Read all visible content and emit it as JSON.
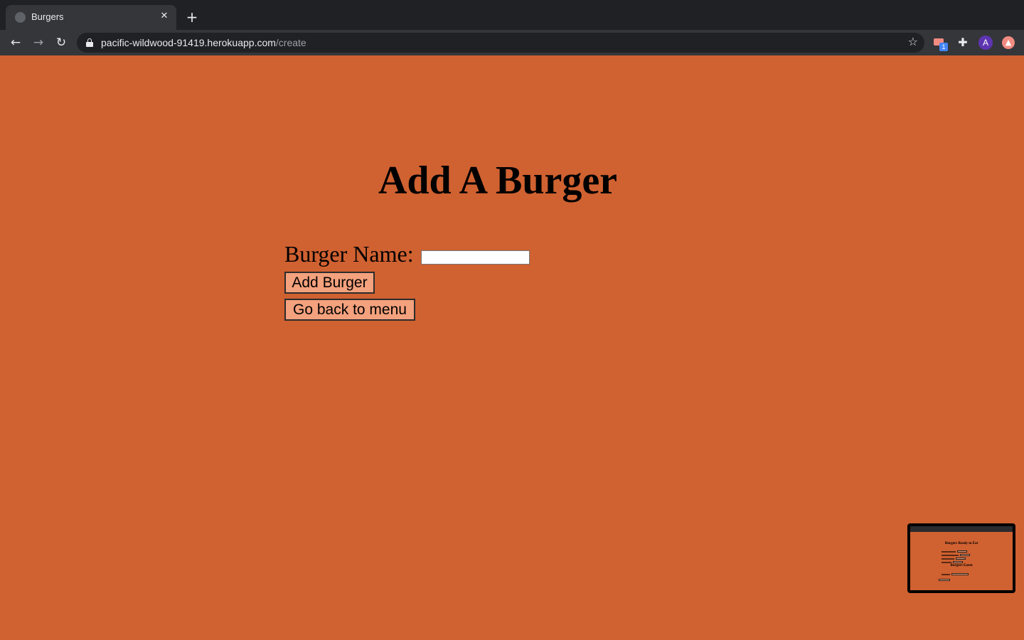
{
  "browser": {
    "tab_title": "Burgers",
    "tab_close": "✕",
    "new_tab": "+",
    "url_host": "pacific-wildwood-91419.herokuapp.com",
    "url_path": "/create",
    "extension_badge": "1",
    "avatar_letter": "A"
  },
  "page": {
    "title": "Add A Burger",
    "name_label": "Burger Name:",
    "name_value": "",
    "add_button": "Add Burger",
    "back_button": "Go back to menu"
  },
  "thumbnail": {
    "heading_1": "Burgers Ready to Eat",
    "heading_2": "Burgers Eaten"
  },
  "colors": {
    "background": "#d06131",
    "button": "#f4a17d"
  }
}
